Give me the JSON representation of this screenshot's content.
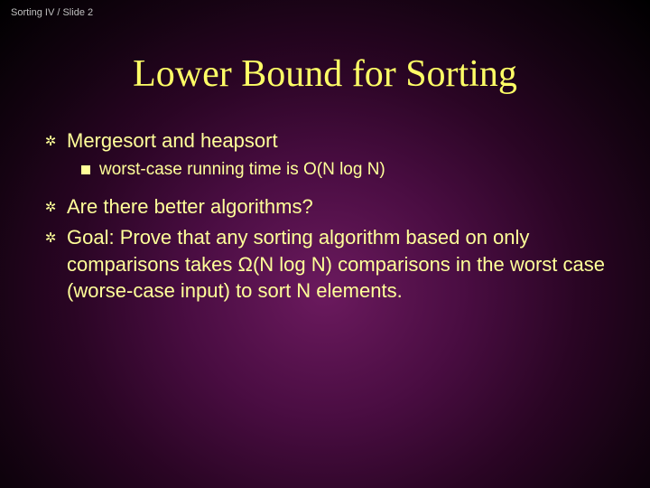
{
  "header": "Sorting IV / Slide 2",
  "title": "Lower Bound for Sorting",
  "bullets": {
    "b1": "Mergesort and heapsort",
    "b1_sub": "worst-case running time is O(N log N)",
    "b2": "Are there better algorithms?",
    "b3": "Goal: Prove that any sorting algorithm based on only comparisons takes Ω(N log N) comparisons in the worst case (worse-case input) to sort N elements."
  }
}
